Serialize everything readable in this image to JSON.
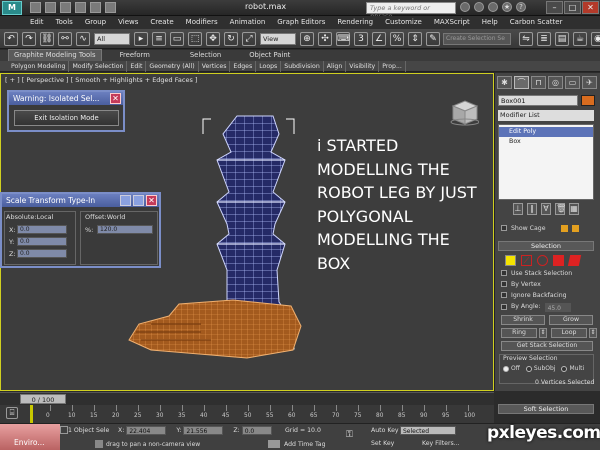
{
  "window": {
    "title": "robot.max",
    "search_placeholder": "Type a keyword or phrase"
  },
  "menu": [
    "Edit",
    "Tools",
    "Group",
    "Views",
    "Create",
    "Modifiers",
    "Animation",
    "Graph Editors",
    "Rendering",
    "Customize",
    "MAXScript",
    "Help",
    "Carbon Scatter"
  ],
  "toolbar": {
    "selection_filter": "All",
    "ref_coord": "View",
    "named_selection": "Create Selection Se"
  },
  "ribbon": {
    "tabs": [
      "Graphite Modeling Tools",
      "Freeform",
      "Selection",
      "Object Paint"
    ],
    "subtabs": [
      "Polygon Modeling",
      "Modify Selection",
      "Edit",
      "Geometry (All)",
      "Vertices",
      "Edges",
      "Loops",
      "Subdivision",
      "Align",
      "Visibility",
      "Prop..."
    ]
  },
  "viewport": {
    "label": "[ + ] [ Perspective ] [ Smooth + Highlights + Edged Faces ]",
    "annotation": "i STARTED MODELLING THE ROBOT LEG BY JUST POLYGONAL MODELLING THE BOX"
  },
  "isolated_panel": {
    "title": "Warning: Isolated Sel...",
    "button": "Exit Isolation Mode"
  },
  "scale_panel": {
    "title": "Scale Transform Type-In",
    "absolute_label": "Absolute:Local",
    "offset_label": "Offset:World",
    "x": "0.0",
    "y": "0.0",
    "z": "0.0",
    "percent_label": "%:",
    "percent": "120.0"
  },
  "command_panel": {
    "object_name": "Box001",
    "object_color": "#d86c1f",
    "modifier_list": "Modifier List",
    "stack": [
      "Edit Poly",
      "Box"
    ],
    "show_cage": "Show Cage",
    "selection_header": "Selection",
    "use_stack": "Use Stack Selection",
    "by_vertex": "By Vertex",
    "ignore_backfacing": "Ignore Backfacing",
    "by_angle": "By Angle:",
    "angle": "45.0",
    "shrink": "Shrink",
    "grow": "Grow",
    "ring": "Ring",
    "loop": "Loop",
    "get_stack": "Get Stack Selection",
    "preview_header": "Preview Selection",
    "off": "Off",
    "subobj": "SubObj",
    "multi": "Multi",
    "vertices_selected": "0 Vertices Selected",
    "soft_selection": "Soft Selection"
  },
  "timeline": {
    "position": "0 / 100",
    "ticks": [
      "0",
      "10",
      "15",
      "20",
      "25",
      "30",
      "35",
      "40",
      "45",
      "50",
      "55",
      "60",
      "65",
      "70",
      "75",
      "80",
      "85",
      "90",
      "95",
      "100"
    ]
  },
  "status": {
    "tab": "Enviro...",
    "object_sel": "1 Object Sele",
    "message": "drag to pan a non-camera view",
    "x": "22.404",
    "y": "21.556",
    "z": "0.0",
    "grid": "Grid = 10.0",
    "add_time_tag": "Add Time Tag",
    "auto_key": "Auto Key",
    "auto_key_value": "Selected",
    "set_key": "Set Key",
    "key_filters": "Key Filters..."
  },
  "watermark": "pxleyes.com"
}
